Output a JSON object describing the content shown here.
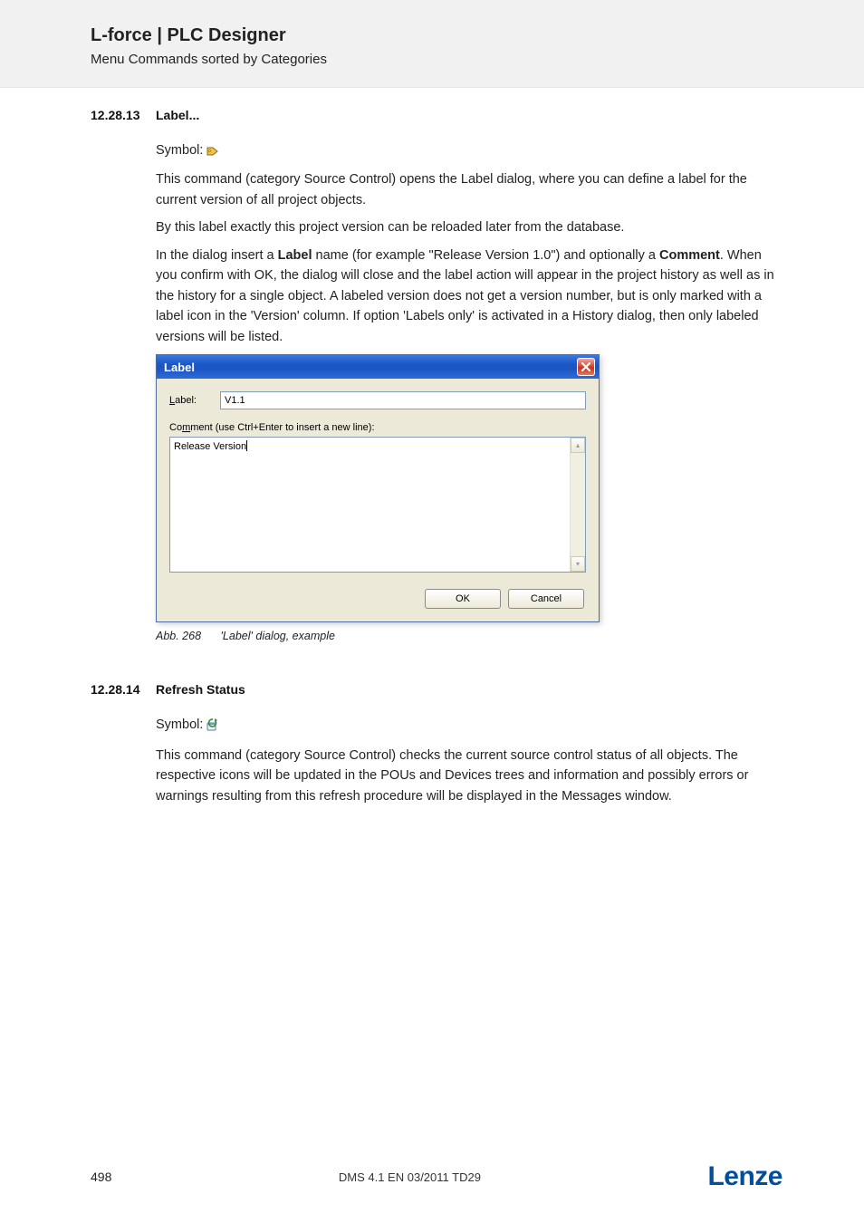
{
  "header": {
    "title": "L-force | PLC Designer",
    "subtitle": "Menu Commands sorted by Categories"
  },
  "section1": {
    "num": "12.28.13",
    "title": "Label...",
    "symbol_label": "Symbol:",
    "p1": "This command (category Source Control) opens the Label dialog, where you can define a label for the current version of all project objects.",
    "p2": "By this label exactly this project version can be reloaded later from the database.",
    "p3a": "In the dialog insert a ",
    "p3_label": "Label",
    "p3b": " name (for example \"Release Version 1.0\") and optionally a ",
    "p3_comment": "Comment",
    "p3c": ". When you confirm with OK, the dialog will close and the label action will appear in the project history as well as in the history for a single object. A labeled version does not get a version number, but is only marked with a label icon in the 'Version' column. If option 'Labels only' is activated in a History dialog, then only labeled versions will be listed."
  },
  "dialog": {
    "title": "Label",
    "label_prefix": "L",
    "label_rest": "abel:",
    "label_value": "V1.1",
    "comment_pre": "Co",
    "comment_underline": "m",
    "comment_post": "ment (use Ctrl+Enter to insert a new line):",
    "comment_value": "Release Version",
    "ok": "OK",
    "cancel": "Cancel"
  },
  "caption": {
    "abb": "Abb. 268",
    "text": "'Label' dialog, example"
  },
  "section2": {
    "num": "12.28.14",
    "title": "Refresh Status",
    "symbol_label": "Symbol:",
    "p1": "This command (category Source Control) checks the current source control status of all objects. The respective icons will be updated in the POUs and Devices trees and information and possibly errors or warnings resulting from this refresh procedure will be displayed in the Messages window."
  },
  "footer": {
    "page": "498",
    "docid": "DMS 4.1 EN 03/2011 TD29",
    "brand": "Lenze"
  }
}
